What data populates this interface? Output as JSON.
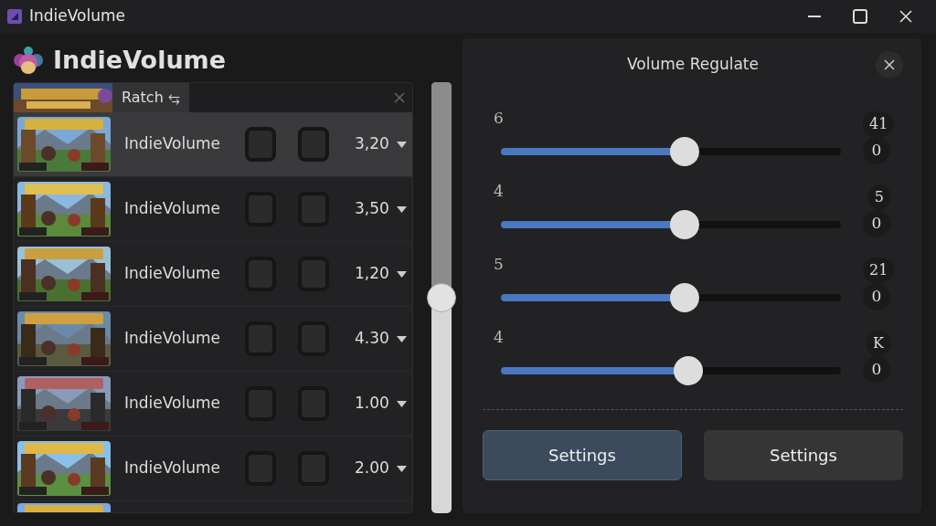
{
  "window": {
    "title": "IndieVolume"
  },
  "app": {
    "title": "IndieVolume"
  },
  "list": {
    "tab": "Ratch ⥃",
    "rows": [
      {
        "kind": "row",
        "name": "IndieVolume",
        "value": "3,20",
        "selected": true
      },
      {
        "kind": "row",
        "name": "IndieVolume",
        "value": "3,50",
        "selected": false
      },
      {
        "kind": "row",
        "name": "IndieVolume",
        "value": "1,20",
        "selected": false
      },
      {
        "kind": "row",
        "name": "IndieVolume",
        "value": "4.30",
        "selected": false
      },
      {
        "kind": "row",
        "name": "IndieVolume",
        "value": "1.00",
        "selected": false
      },
      {
        "kind": "row",
        "name": "IndieVolume",
        "value": "2.00",
        "selected": false
      },
      {
        "kind": "partial",
        "selected": false
      }
    ],
    "scroll": {
      "level": 0.5
    }
  },
  "panel": {
    "title": "Volume Regulate",
    "sliders": [
      {
        "label": "6",
        "level": 0.54,
        "badge": "41",
        "reading": "0"
      },
      {
        "label": "4",
        "level": 0.54,
        "badge": "5",
        "reading": "0"
      },
      {
        "label": "5",
        "level": 0.54,
        "badge": "21",
        "reading": "0"
      },
      {
        "label": "4",
        "level": 0.55,
        "badge": "K",
        "reading": "0"
      }
    ],
    "buttons": [
      {
        "label": "Settings",
        "selected": true
      },
      {
        "label": "Settings",
        "selected": false
      }
    ]
  }
}
